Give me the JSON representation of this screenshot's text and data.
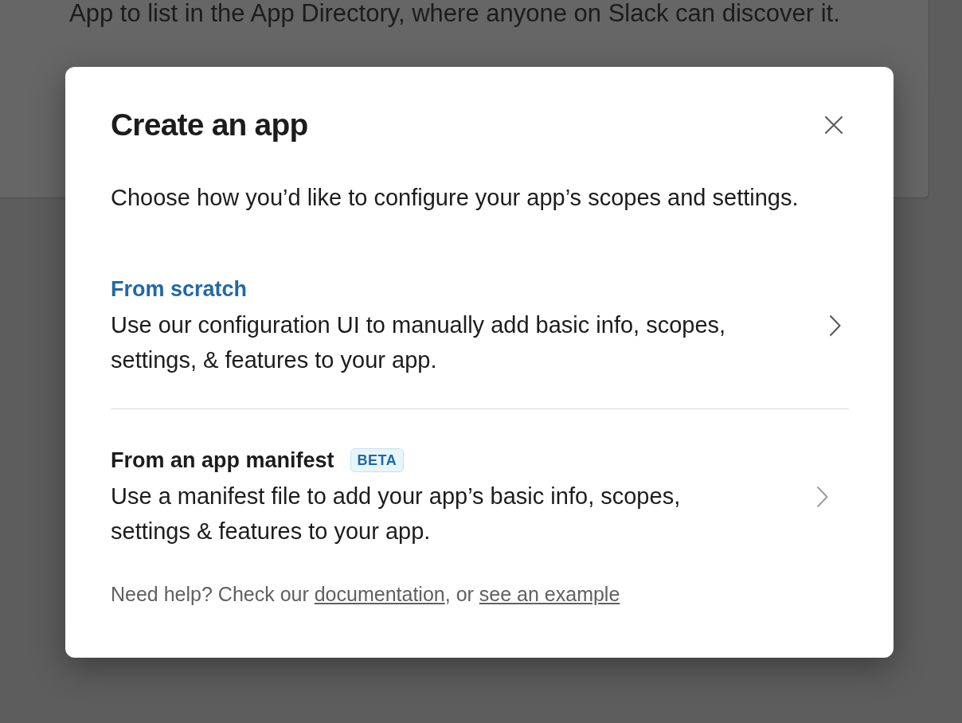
{
  "background_page": {
    "text": "App to list in the App Directory, where anyone on Slack can discover it."
  },
  "dialog": {
    "title": "Create an app",
    "description": "Choose how you’d like to configure your app’s scopes and settings.",
    "options": [
      {
        "title": "From scratch",
        "description": "Use our configuration UI to manually add basic info, scopes, settings, & features to your app.",
        "highlighted": true
      },
      {
        "title": "From an app manifest",
        "badge": "BETA",
        "description": "Use a manifest file to add your app’s basic info, scopes, settings & features to your app.",
        "highlighted": false
      }
    ],
    "help": [
      {
        "kind": "text",
        "text": "Need help? Check our "
      },
      {
        "kind": "link",
        "text": "documentation"
      },
      {
        "kind": "text",
        "text": ", or "
      },
      {
        "kind": "link",
        "text": "see an example"
      }
    ]
  }
}
